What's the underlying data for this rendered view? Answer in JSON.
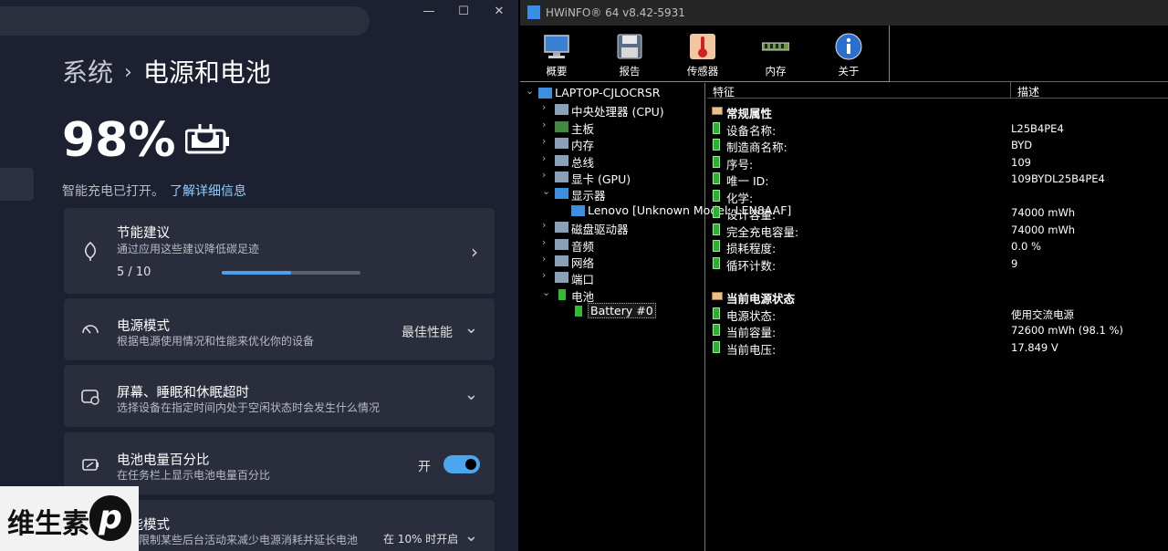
{
  "settings": {
    "window_controls": {
      "minimize": "—",
      "maximize": "☐",
      "close": "✕"
    },
    "breadcrumb": {
      "parent": "系统",
      "separator": "›",
      "current": "电源和电池"
    },
    "battery_percent": "98%",
    "smart_charging": {
      "text": "智能充电已打开。",
      "link": "了解详细信息"
    },
    "cards": [
      {
        "icon": "leaf-icon",
        "title": "节能建议",
        "subtitle": "通过应用这些建议降低碳足迹",
        "progress_text": "5 / 10",
        "progress": 0.5,
        "chevron": "›"
      },
      {
        "icon": "gauge-icon",
        "title": "电源模式",
        "subtitle": "根据电源使用情况和性能来优化你的设备",
        "value": "最佳性能",
        "chevron": "⌄"
      },
      {
        "icon": "sleep-screen-icon",
        "title": "屏幕、睡眠和休眠超时",
        "subtitle": "选择设备在指定时间内处于空闲状态时会发生什么情况",
        "chevron": "⌄"
      },
      {
        "icon": "battery-percent-icon",
        "title": "电池电量百分比",
        "subtitle": "在任务栏上显示电池电量百分比",
        "value": "开",
        "toggle_on": true
      },
      {
        "icon": "battery-saver-icon",
        "title": "节能模式",
        "subtitle": "通过限制某些后台活动来减少电源消耗并延长电池",
        "value": "在 10% 时开启",
        "chevron": "⌄"
      }
    ],
    "watermark": {
      "text": "维生素",
      "logo": "p"
    }
  },
  "hwinfo": {
    "title": "HWiNFO® 64 v8.42-5931",
    "toolbar": [
      {
        "icon": "monitor-icon",
        "label": "概要"
      },
      {
        "icon": "floppy-disk-icon",
        "label": "报告"
      },
      {
        "icon": "thermometer-icon",
        "label": "传感器"
      },
      {
        "icon": "memory-icon",
        "label": "内存"
      },
      {
        "icon": "info-icon",
        "label": "关于"
      }
    ],
    "tree": [
      {
        "arrow": "⌄",
        "icon": "computer-icon",
        "label": "LAPTOP-CJLOCRSR",
        "level": 0
      },
      {
        "arrow": "›",
        "icon": "cpu-icon",
        "label": "中央处理器 (CPU)",
        "level": 1
      },
      {
        "arrow": "›",
        "icon": "motherboard-icon",
        "label": "主板",
        "level": 1
      },
      {
        "arrow": "›",
        "icon": "memory-icon",
        "label": "内存",
        "level": 1
      },
      {
        "arrow": "›",
        "icon": "bus-icon",
        "label": "总线",
        "level": 1
      },
      {
        "arrow": "›",
        "icon": "gpu-icon",
        "label": "显卡 (GPU)",
        "level": 1
      },
      {
        "arrow": "⌄",
        "icon": "display-icon",
        "label": "显示器",
        "level": 1
      },
      {
        "arrow": "",
        "icon": "display-icon",
        "label": "Lenovo [Unknown Model: LEN8AAF]",
        "level": 2
      },
      {
        "arrow": "›",
        "icon": "drive-icon",
        "label": "磁盘驱动器",
        "level": 1
      },
      {
        "arrow": "›",
        "icon": "audio-icon",
        "label": "音频",
        "level": 1
      },
      {
        "arrow": "›",
        "icon": "network-icon",
        "label": "网络",
        "level": 1
      },
      {
        "arrow": "›",
        "icon": "port-icon",
        "label": "端口",
        "level": 1
      },
      {
        "arrow": "⌄",
        "icon": "battery-icon",
        "label": "电池",
        "level": 1
      },
      {
        "arrow": "",
        "icon": "battery-icon",
        "label": "Battery #0",
        "level": 2,
        "selected": true
      }
    ],
    "columns": {
      "feature": "特征",
      "description": "描述"
    },
    "sections": [
      {
        "title": "常规属性",
        "rows": [
          {
            "label": "设备名称:",
            "value": "L25B4PE4"
          },
          {
            "label": "制造商名称:",
            "value": "BYD"
          },
          {
            "label": "序号:",
            "value": "  109"
          },
          {
            "label": "唯一 ID:",
            "value": "  109BYDL25B4PE4"
          },
          {
            "label": "化学:",
            "value": ""
          },
          {
            "label": "设计容量:",
            "value": "74000 mWh"
          },
          {
            "label": "完全充电容量:",
            "value": "74000 mWh"
          },
          {
            "label": "损耗程度:",
            "value": "0.0 %"
          },
          {
            "label": "循环计数:",
            "value": "9"
          }
        ]
      },
      {
        "title": "当前电源状态",
        "rows": [
          {
            "label": "电源状态:",
            "value": "使用交流电源"
          },
          {
            "label": "当前容量:",
            "value": "72600 mWh (98.1 %)"
          },
          {
            "label": "当前电压:",
            "value": "17.849 V"
          }
        ]
      }
    ]
  }
}
